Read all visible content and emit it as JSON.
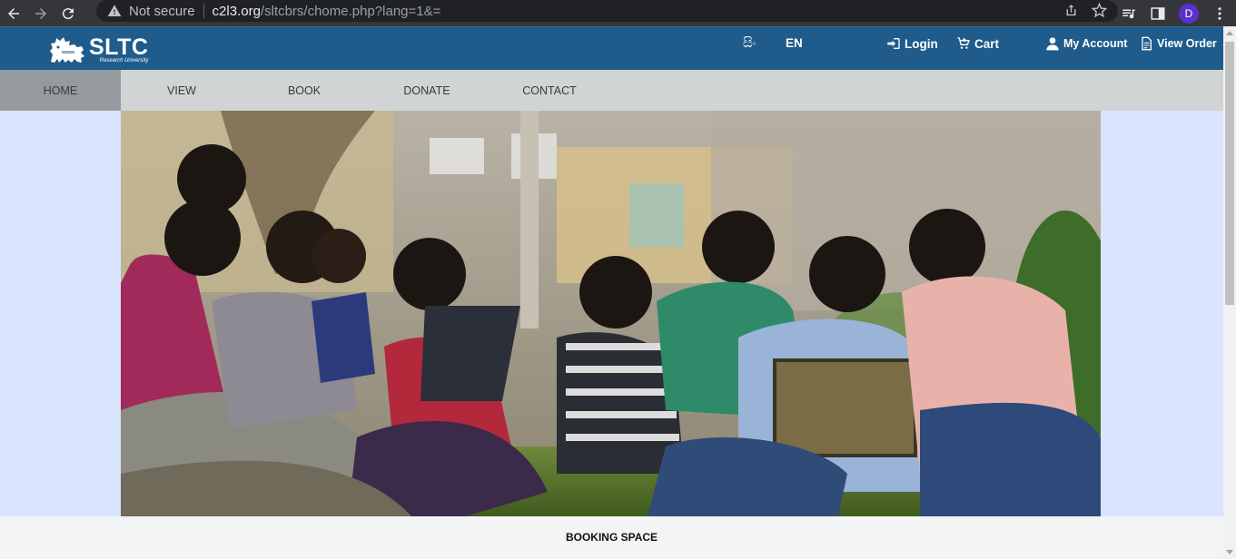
{
  "browser": {
    "security_label": "Not secure",
    "url_host": "c2l3.org",
    "url_path": "/sltcbrs/chome.php?lang=1&=",
    "profile_initial": "D"
  },
  "header": {
    "brand": "SLTC",
    "brand_sub": "Research University",
    "lang_si": "සිං",
    "lang_en": "EN",
    "login": "Login",
    "cart": "Cart",
    "account": "My Account",
    "view_order": "View Order"
  },
  "nav": {
    "home": "HOME",
    "view": "VIEW",
    "book": "BOOK",
    "donate": "DONATE",
    "contact": "CONTACT"
  },
  "section": {
    "booking_title": "BOOKING SPACE"
  },
  "colors": {
    "header_bg": "#1f5c8c",
    "nav_bg": "#d0d4d5",
    "nav_active": "#969a9c",
    "hero_side": "#d9e5fd"
  }
}
